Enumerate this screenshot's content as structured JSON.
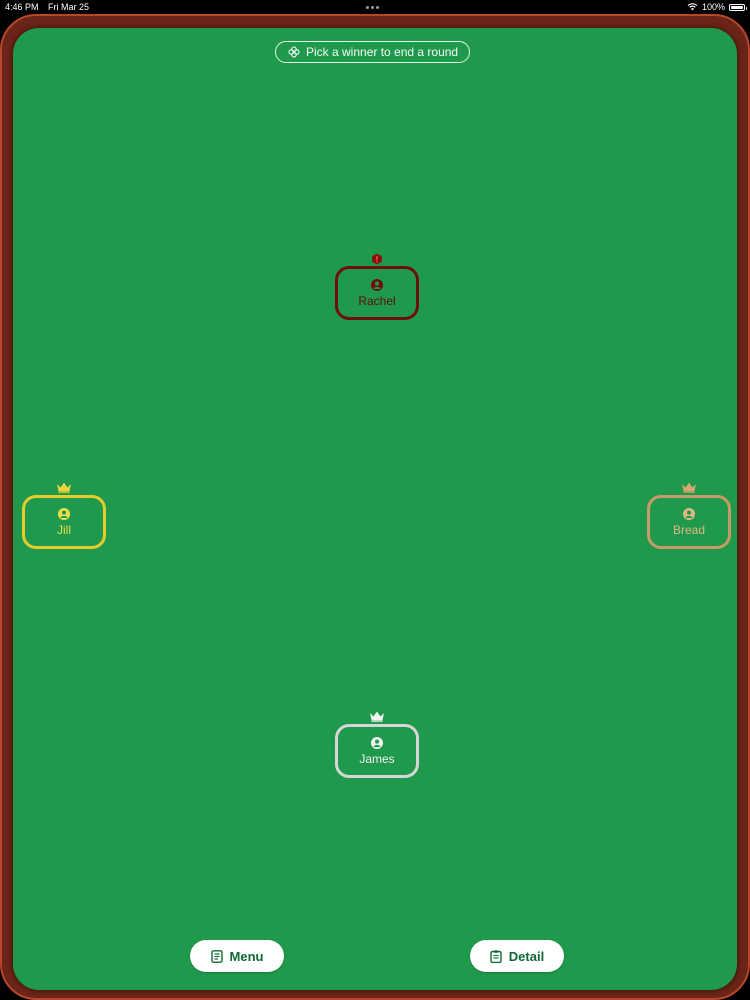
{
  "status_bar": {
    "time": "4:46 PM",
    "date": "Fri Mar 25",
    "battery": "100%"
  },
  "hint": {
    "text": "Pick a winner to end a round",
    "icon": "clover-icon"
  },
  "players": [
    {
      "name": "Rachel",
      "border_color": "#6e0f0b",
      "text_color": "#5e0c09",
      "marker": "alert-icon"
    },
    {
      "name": "Jill",
      "border_color": "#e5cc2a",
      "text_color": "#f0dc4a",
      "marker": "crown-icon"
    },
    {
      "name": "Bread",
      "border_color": "#c89a68",
      "text_color": "#e2b684",
      "marker": "crown-icon"
    },
    {
      "name": "James",
      "border_color": "#d6d6d6",
      "text_color": "#f1f1f1",
      "marker": "crown-icon"
    }
  ],
  "buttons": {
    "menu": {
      "label": "Menu",
      "icon": "document-icon"
    },
    "detail": {
      "label": "Detail",
      "icon": "clipboard-icon"
    }
  },
  "colors": {
    "felt": "#1f9a4c",
    "frame": "#6a2418",
    "frame_rim": "#b8462a",
    "button_text": "#0e6a35"
  }
}
